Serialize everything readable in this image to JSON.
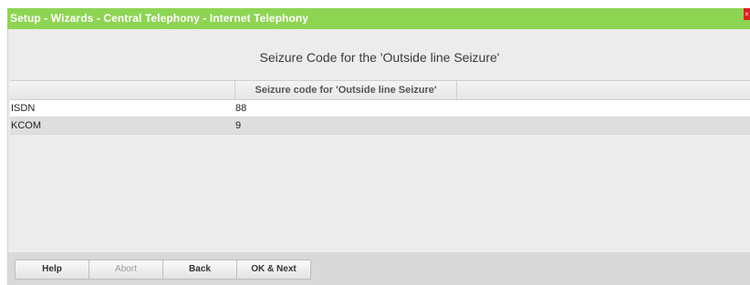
{
  "window": {
    "title": "Setup - Wizards - Central Telephony - Internet Telephony",
    "close_glyph": "×"
  },
  "main": {
    "heading": "Seizure Code for the 'Outside line Seizure'",
    "table": {
      "columns": [
        "",
        "Seizure code for 'Outside line Seizure'",
        ""
      ],
      "rows": [
        {
          "name": "ISDN",
          "code": "88"
        },
        {
          "name": "KCOM",
          "code": "9"
        }
      ]
    }
  },
  "footer": {
    "help_label": "Help",
    "abort_label": "Abort",
    "back_label": "Back",
    "ok_next_label": "OK & Next"
  },
  "colors": {
    "titlebar": "#8ed453",
    "panel": "#ececec",
    "close": "#e02020"
  }
}
